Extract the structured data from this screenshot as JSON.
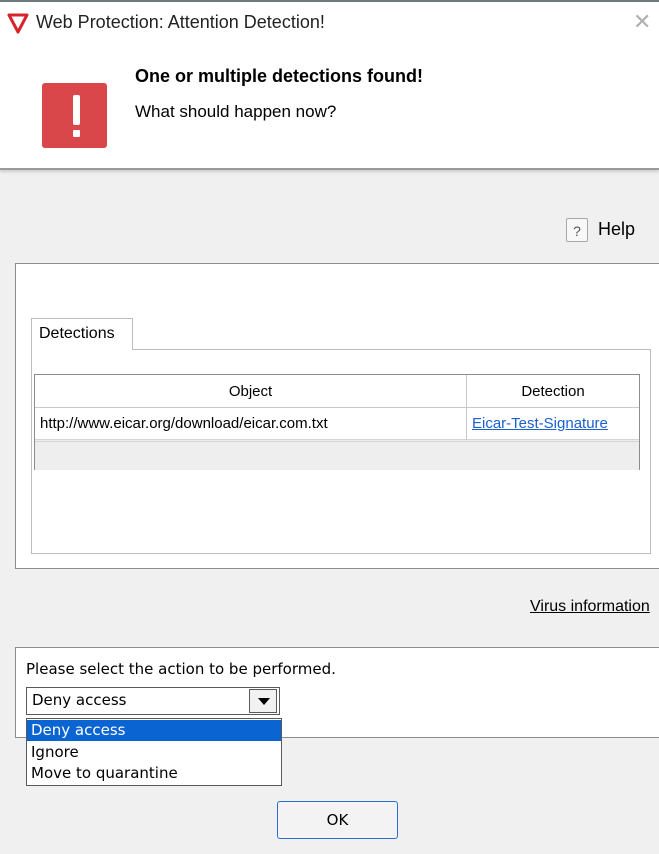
{
  "window": {
    "title": "Web Protection: Attention Detection!",
    "accent_color": "#d9474b"
  },
  "header": {
    "heading": "One or multiple detections found!",
    "subheading": "What should happen now?"
  },
  "help": {
    "icon_glyph": "?",
    "label": "Help"
  },
  "detections": {
    "tab_label": "Detections",
    "columns": [
      "Object",
      "Detection"
    ],
    "rows": [
      {
        "object": "http://www.eicar.org/download/eicar.com.txt",
        "detection": "Eicar-Test-Signature"
      }
    ]
  },
  "virus_information": {
    "label": "Virus information"
  },
  "action": {
    "prompt": "Please select the action to be performed.",
    "selected": "Deny access",
    "options": [
      "Deny access",
      "Ignore",
      "Move to quarantine"
    ]
  },
  "ok_button": {
    "label": "OK"
  }
}
